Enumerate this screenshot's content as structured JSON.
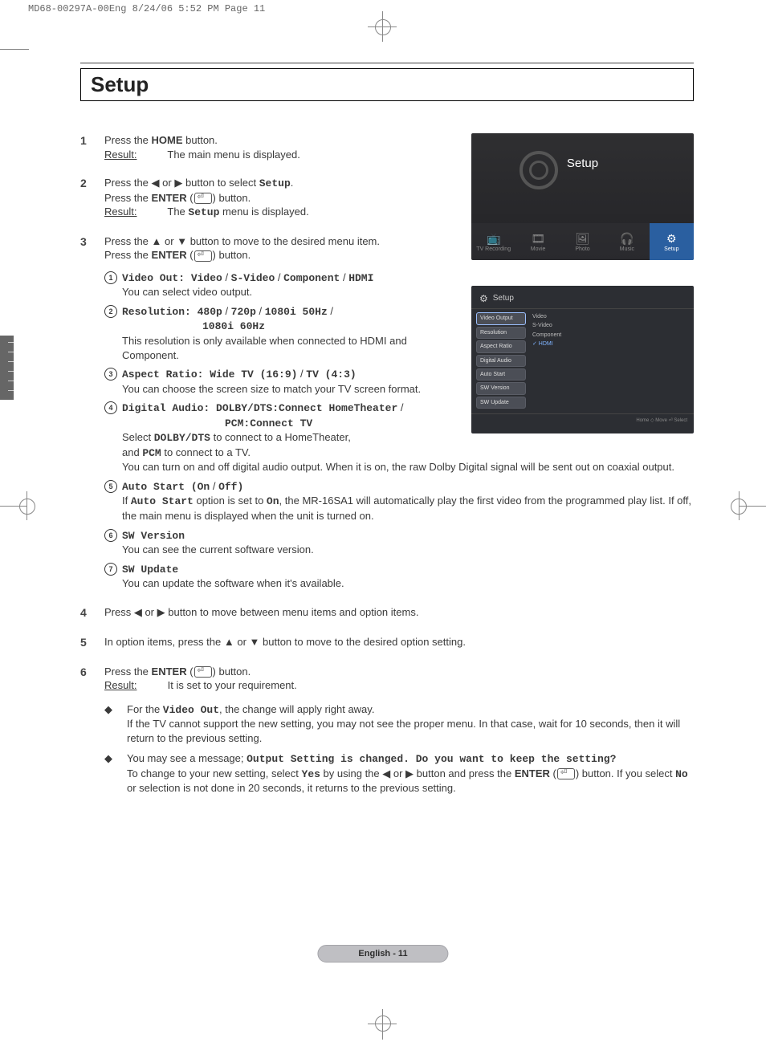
{
  "print_header": "MD68-00297A-00Eng  8/24/06  5:52 PM  Page 11",
  "section_title": "Setup",
  "steps": {
    "s1": {
      "num": "1",
      "line1a": "Press the ",
      "home": "HOME",
      "line1b": " button.",
      "result_lbl": "Result:",
      "result_txt": "The main menu is displayed."
    },
    "s2": {
      "num": "2",
      "a1": "Press the ",
      "left": "◀",
      "or": " or ",
      "right": "▶",
      "a2": " button to select ",
      "setup": "Setup",
      "a3": ".",
      "b1": "Press the ",
      "enter": "ENTER",
      "b2": " (",
      "b3": ") button.",
      "result_lbl": "Result:",
      "result1": "The ",
      "result_setup": "Setup",
      "result2": " menu is displayed."
    },
    "s3": {
      "num": "3",
      "a1": "Press the ",
      "up": "▲",
      "or": " or ",
      "down": "▼",
      "a2": " button to move to the desired menu item.",
      "b1": "Press the ",
      "enter": "ENTER",
      "b2": " (",
      "b3": ") button."
    },
    "s4": {
      "num": "4",
      "a1": "Press ",
      "left": "◀",
      "or": " or ",
      "right": "▶",
      "a2": " button to move between menu items and option items."
    },
    "s5": {
      "num": "5",
      "a1": "In option items, press the ",
      "up": "▲",
      "or": " or ",
      "down": "▼",
      "a2": " button to move to the desired option setting."
    },
    "s6": {
      "num": "6",
      "a1": "Press the ",
      "enter": "ENTER",
      "a2": " (",
      "a3": ") button.",
      "result_lbl": "Result:",
      "result_txt": "It is set to your requirement."
    }
  },
  "subitems": {
    "i1": {
      "n": "1",
      "t1": "Video Out: Video",
      "sl1": " / ",
      "t2": "S-Video",
      "sl2": " / ",
      "t3": "Component",
      "sl3": " / ",
      "t4": "HDMI",
      "desc": "You can select video output."
    },
    "i2": {
      "n": "2",
      "t1": "Resolution: 480p",
      "sl1": " / ",
      "t2": "720p",
      "sl2": " / ",
      "t3": "1080i 50Hz",
      "sl3": " /",
      "t4": "1080i 60Hz",
      "desc": "This resolution is only available when connected to HDMI and Component."
    },
    "i3": {
      "n": "3",
      "t1": "Aspect Ratio: Wide TV (16:9)",
      "sl1": " / ",
      "t2": "TV (4:3)",
      "desc": "You can choose the screen size to match your TV screen format."
    },
    "i4": {
      "n": "4",
      "t1": "Digital Audio: DOLBY/DTS:Connect HomeTheater",
      "sl1": " /",
      "t2": "PCM:Connect TV",
      "d1": "Select ",
      "d_bold1": "DOLBY/DTS",
      "d2": " to connect to a HomeTheater,",
      "d3": "and ",
      "d_bold2": "PCM",
      "d4": " to connect to a TV.",
      "d5": "You can turn on and off digital audio output. When it is on, the raw Dolby Digital signal will be sent out on coaxial output."
    },
    "i5": {
      "n": "5",
      "t1": "Auto Start (On",
      "sl1": " / ",
      "t2": "Off)",
      "d1": "If ",
      "d_bold1": "Auto Start",
      "d2": " option is set to ",
      "d_bold2": "On",
      "d3": ", the MR-16SA1 will automatically play the first video from the programmed play list. If off, the main menu is displayed when the unit is turned on."
    },
    "i6": {
      "n": "6",
      "t1": "SW Version",
      "desc": "You can see the current software version."
    },
    "i7": {
      "n": "7",
      "t1": "SW Update",
      "desc": "You can update the software when it's available."
    }
  },
  "notes": {
    "n1": {
      "a": "For the ",
      "bold": "Video Out",
      "b": ", the change will apply right away.",
      "c": "If the TV cannot support the new setting, you may not see the proper menu. In that case, wait for 10 seconds, then it will return to the previous setting."
    },
    "n2": {
      "a": "You may see a message; ",
      "msg": "Output Setting is changed. Do you want to keep the setting?",
      "b": "To change to your new setting, select ",
      "yes": "Yes",
      "c": " by using the ",
      "left": "◀",
      "or": " or ",
      "right": "▶",
      "d": " button and press the ",
      "enter": "ENTER",
      "e": " (",
      "f": ") button. If you select ",
      "no": "No",
      "g": " or selection is not done in 20 seconds, it returns to the previous setting."
    }
  },
  "shot1": {
    "title": "Setup",
    "items": [
      {
        "label": "TV Recording",
        "icon": "📺"
      },
      {
        "label": "Movie",
        "icon": "🎞"
      },
      {
        "label": "Photo",
        "icon": "🖼"
      },
      {
        "label": "Music",
        "icon": "🎧"
      },
      {
        "label": "Setup",
        "icon": "⚙",
        "active": true
      }
    ]
  },
  "shot2": {
    "title": "Setup",
    "left": [
      "Video Output",
      "Resolution",
      "Aspect Ratio",
      "Digital Audio",
      "Auto Start",
      "SW Version",
      "SW Update"
    ],
    "left_active": 0,
    "right": [
      "Video",
      "S-Video",
      "Component",
      "HDMI"
    ],
    "right_sel": 3,
    "foot": "Home   ◇ Move   ⏎ Select"
  },
  "footer": "English - 11"
}
